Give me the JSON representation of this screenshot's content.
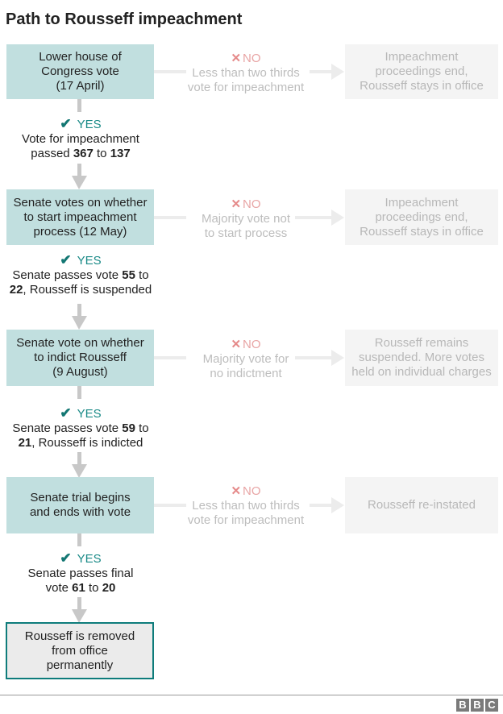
{
  "title": "Path to Rousseff impeachment",
  "colors": {
    "step_fill": "#c1dfdf",
    "outcome_fill": "#f4f4f4",
    "final_border": "#0e7c7b",
    "yes": "#1a8a87",
    "no": "#e58a8a",
    "connector": "#c8c8c8"
  },
  "steps": [
    {
      "label": "Lower house of\nCongress vote\n(17 April)",
      "no": {
        "label": "NO",
        "text": "Less than two thirds\nvote for impeachment"
      },
      "outcome": "Impeachment\nproceedings end,\nRousseff stays in office",
      "yes": {
        "label": "YES",
        "pre": "Vote for impeachment\npassed ",
        "votes_for": "367",
        "mid": " to ",
        "votes_against": "137",
        "post": ""
      }
    },
    {
      "label": "Senate votes on whether\nto start impeachment\nprocess (12 May)",
      "no": {
        "label": "NO",
        "text": "Majority vote not\nto start process"
      },
      "outcome": "Impeachment\nproceedings end,\nRousseff stays in office",
      "yes": {
        "label": "YES",
        "pre": "Senate passes vote ",
        "votes_for": "55",
        "mid": " to\n",
        "votes_against": "22",
        "post": ", Rousseff is suspended"
      }
    },
    {
      "label": "Senate vote on whether\nto indict Rousseff\n(9 August)",
      "no": {
        "label": "NO",
        "text": "Majority vote for\nno indictment"
      },
      "outcome": "Rousseff remains\nsuspended. More votes\nheld on individual charges",
      "yes": {
        "label": "YES",
        "pre": "Senate passes vote ",
        "votes_for": "59",
        "mid": " to\n",
        "votes_against": "21",
        "post": ", Rousseff is indicted"
      }
    },
    {
      "label": "Senate trial begins\nand ends with vote",
      "no": {
        "label": "NO",
        "text": "Less than two thirds\nvote for impeachment"
      },
      "outcome": "Rousseff re-instated",
      "yes": {
        "label": "YES",
        "pre": "Senate passes final\nvote ",
        "votes_for": "61",
        "mid": " to ",
        "votes_against": "20",
        "post": ""
      }
    }
  ],
  "final": "Rousseff is removed\nfrom office\npermanently",
  "footer": {
    "logo": [
      "B",
      "B",
      "C"
    ]
  }
}
